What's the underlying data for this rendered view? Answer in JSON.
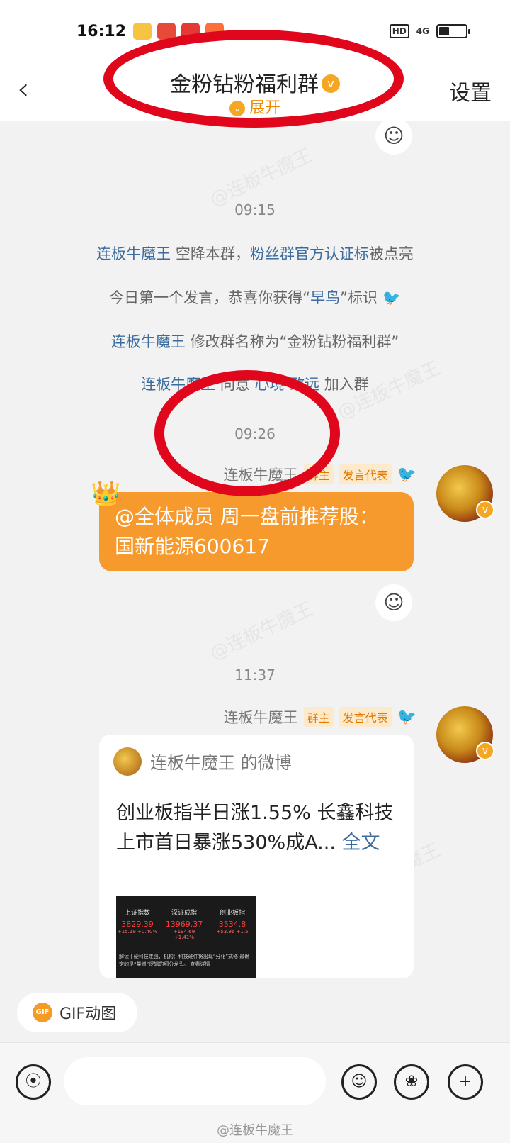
{
  "status_bar": {
    "time": "16:12",
    "hd": "HD",
    "signal": "4G"
  },
  "header": {
    "back_icon": "back-chevron-icon",
    "title": "金粉钻粉福利群",
    "title_badge": "v",
    "expand_label": "展开",
    "settings_label": "设置"
  },
  "chat": {
    "timestamps": [
      "09:15",
      "09:26",
      "11:37"
    ],
    "system_lines": [
      {
        "link1": "连板牛魔王",
        "text": " 空降本群，",
        "link2": "粉丝群官方认证标",
        "text2": "被点亮"
      },
      {
        "text": "今日第一个发言，恭喜你获得“",
        "link": "早鸟",
        "text2": "”标识"
      },
      {
        "link1": "连板牛魔王",
        "text": " 修改群名称为“金粉钻粉福利群”"
      },
      {
        "link1": "连板牛魔王",
        "text": " 同意 ",
        "link2": "心境-致远",
        "text2": " 加入群"
      }
    ],
    "messages": [
      {
        "sender": "连板牛魔王",
        "tag1": "群主",
        "tag2": "发言代表",
        "text": "@全体成员 周一盘前推荐股：国新能源600617"
      },
      {
        "sender": "连板牛魔王",
        "tag1": "群主",
        "tag2": "发言代表",
        "card_title": "连板牛魔王 的微博",
        "card_text": "创业板指半日涨1.55% 长鑫科技上市首日暴涨530%成A...",
        "card_more": " 全文",
        "thumb": {
          "cols": [
            {
              "name": "上证指数",
              "value": "3829.39",
              "change": "+15.19 +0.40%"
            },
            {
              "name": "深证成指",
              "value": "13969.37",
              "change": "+194.69 +1.41%"
            },
            {
              "name": "创业板指",
              "value": "3534.8",
              "change": "+53.96 +1.5"
            }
          ],
          "caption": "解读 | 硬科技走强，机构：科技硬件将出现“分化”式修 最确定的是“量增”逻辑的细分龙头。 查看详情"
        }
      }
    ]
  },
  "gif_button": {
    "badge": "GIF",
    "label": "GIF动图"
  },
  "watermark": "@连板牛魔王",
  "bg_watermark": "@连板牛魔王"
}
